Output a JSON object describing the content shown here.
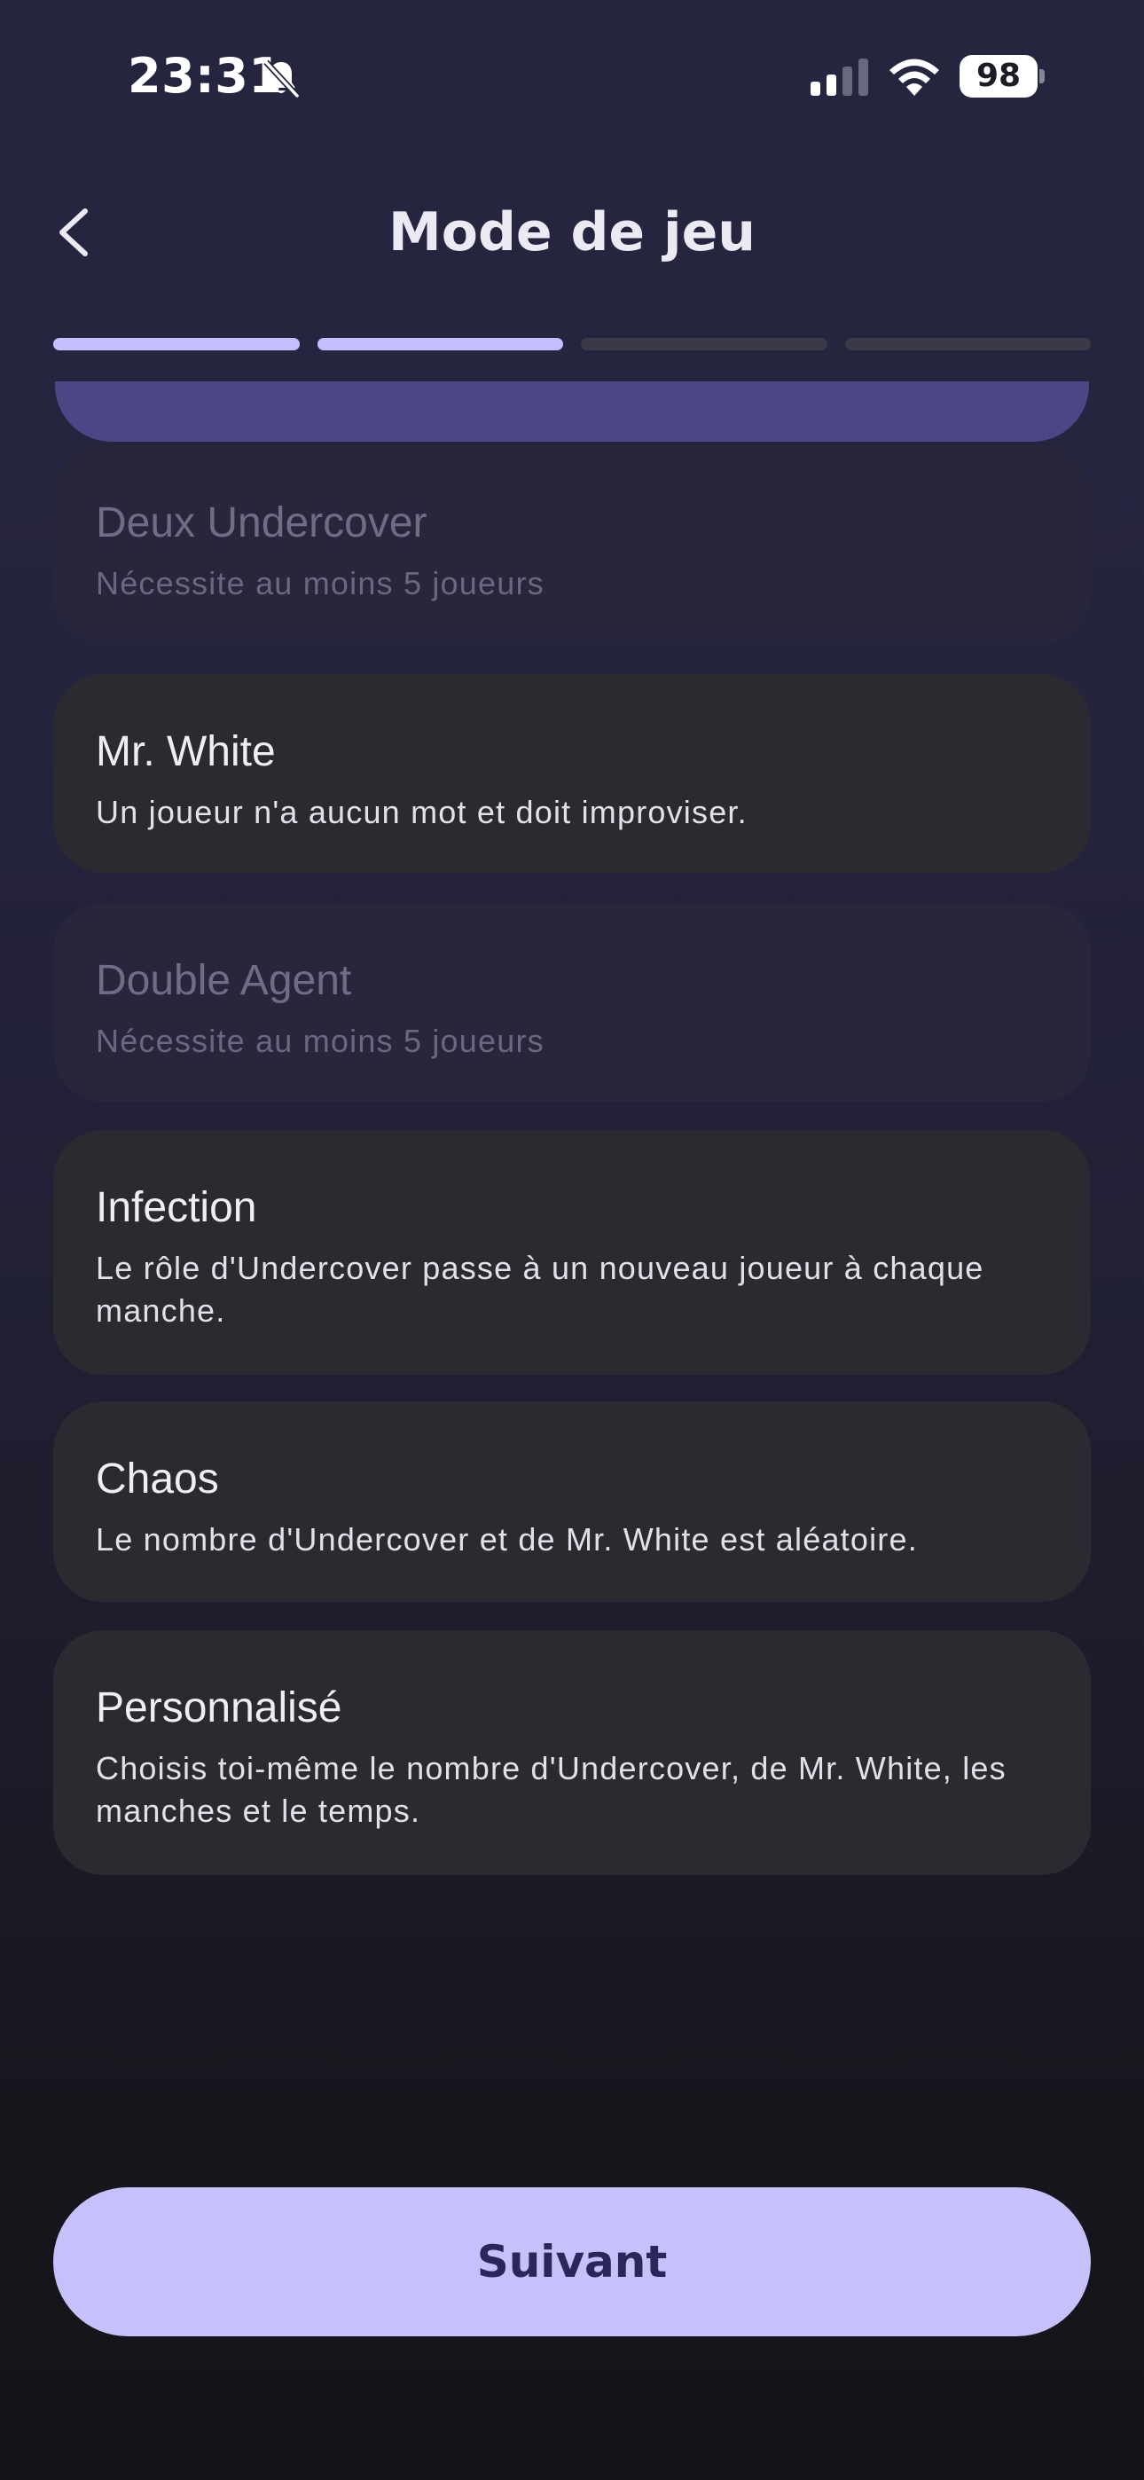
{
  "status_bar": {
    "time": "23:31",
    "battery": "98",
    "icons": [
      "bell-muted-icon",
      "cellular-signal-icon",
      "wifi-icon",
      "battery-icon"
    ]
  },
  "header": {
    "title": "Mode de jeu",
    "back_icon": "chevron-left-icon"
  },
  "progress": {
    "total_steps": 4,
    "completed_steps": 2,
    "active_color": "#c6bfff",
    "inactive_color": "#3a3945"
  },
  "modes": [
    {
      "title": "Deux Undercover",
      "description": "Nécessite au moins 5 joueurs",
      "disabled": true
    },
    {
      "title": "Mr. White",
      "description": "Un joueur n'a aucun mot et doit improviser.",
      "disabled": false
    },
    {
      "title": "Double Agent",
      "description": "Nécessite au moins 5 joueurs",
      "disabled": true
    },
    {
      "title": "Infection",
      "description": "Le rôle d'Undercover passe à un nouveau joueur à chaque manche.",
      "disabled": false
    },
    {
      "title": "Chaos",
      "description": "Le nombre d'Undercover et de Mr. White est aléatoire.",
      "disabled": false
    },
    {
      "title": "Personnalisé",
      "description": "Choisis toi-même le nombre d'Undercover, de Mr. White, les manches et le temps.",
      "disabled": false
    }
  ],
  "next_button": {
    "label": "Suivant",
    "color": "#c6c0fb"
  }
}
